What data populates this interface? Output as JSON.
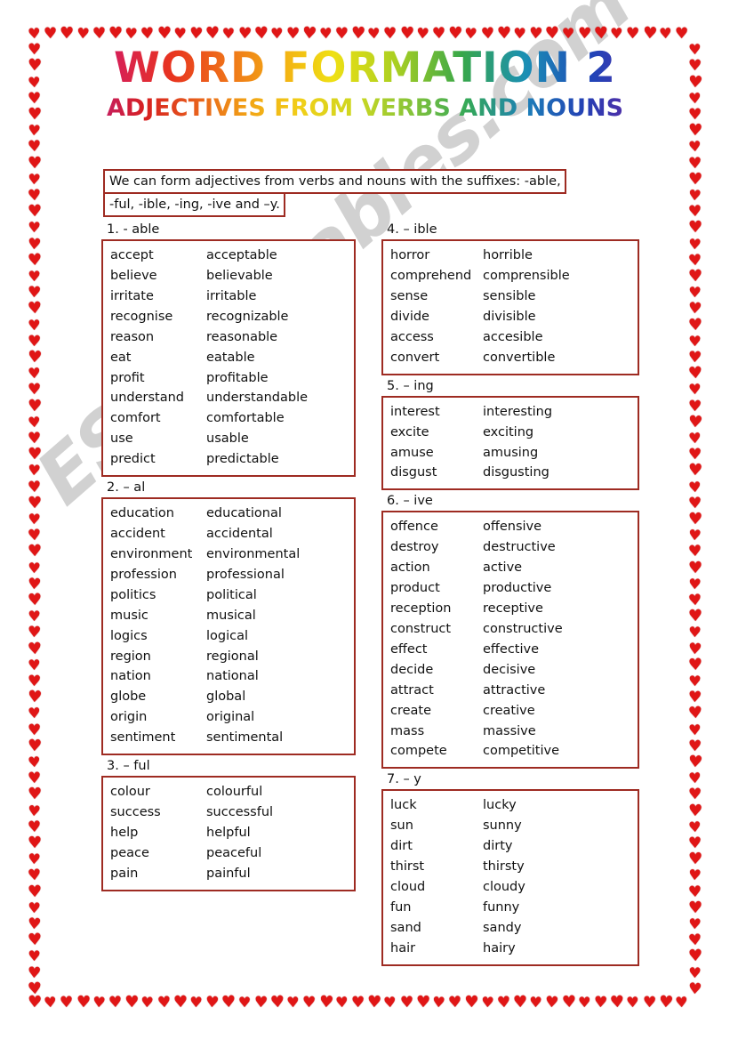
{
  "title": {
    "main": "WORD FORMATION 2",
    "sub": "ADJECTIVES FROM VERBS AND NOUNS"
  },
  "intro": {
    "line1": "We can form adjectives from verbs and nouns with the suffixes: -able,",
    "line2": "-ful, -ible, -ing, -ive and –y."
  },
  "watermark": "ESLprintables.com",
  "colors": {
    "box_border": "#9e2b22",
    "heart": "#e01616",
    "text": "#111111"
  },
  "left_column": [
    {
      "label": "1. - able",
      "rows": [
        {
          "base": "accept",
          "derived": "acceptable"
        },
        {
          "base": "believe",
          "derived": "believable"
        },
        {
          "base": "irritate",
          "derived": "irritable"
        },
        {
          "base": "recognise",
          "derived": "recognizable"
        },
        {
          "base": "reason",
          "derived": "reasonable"
        },
        {
          "base": "eat",
          "derived": "eatable"
        },
        {
          "base": "profit",
          "derived": "profitable"
        },
        {
          "base": "understand",
          "derived": "understandable"
        },
        {
          "base": "comfort",
          "derived": "comfortable"
        },
        {
          "base": "use",
          "derived": "usable"
        },
        {
          "base": "predict",
          "derived": "predictable"
        }
      ]
    },
    {
      "label": "2. – al",
      "rows": [
        {
          "base": "education",
          "derived": "educational"
        },
        {
          "base": "accident",
          "derived": "accidental"
        },
        {
          "base": "environment",
          "derived": "environmental"
        },
        {
          "base": "profession",
          "derived": "professional"
        },
        {
          "base": "politics",
          "derived": "political"
        },
        {
          "base": "music",
          "derived": "musical"
        },
        {
          "base": "logics",
          "derived": "logical"
        },
        {
          "base": "region",
          "derived": "regional"
        },
        {
          "base": "nation",
          "derived": "national"
        },
        {
          "base": "globe",
          "derived": "global"
        },
        {
          "base": "origin",
          "derived": "original"
        },
        {
          "base": "sentiment",
          "derived": "sentimental"
        }
      ]
    },
    {
      "label": "3. – ful",
      "rows": [
        {
          "base": "colour",
          "derived": "colourful"
        },
        {
          "base": "success",
          "derived": "successful"
        },
        {
          "base": "help",
          "derived": "helpful"
        },
        {
          "base": "peace",
          "derived": "peaceful"
        },
        {
          "base": "pain",
          "derived": "painful"
        }
      ]
    }
  ],
  "right_column": [
    {
      "label": "4. – ible",
      "rows": [
        {
          "base": "horror",
          "derived": "horrible"
        },
        {
          "base": "comprehend",
          "derived": "comprensible"
        },
        {
          "base": "sense",
          "derived": "sensible"
        },
        {
          "base": "divide",
          "derived": "divisible"
        },
        {
          "base": "access",
          "derived": "accesible"
        },
        {
          "base": "convert",
          "derived": "convertible"
        }
      ]
    },
    {
      "label": "5. – ing",
      "rows": [
        {
          "base": "interest",
          "derived": "interesting"
        },
        {
          "base": "excite",
          "derived": "exciting"
        },
        {
          "base": "amuse",
          "derived": "amusing"
        },
        {
          "base": "disgust",
          "derived": "disgusting"
        }
      ]
    },
    {
      "label": "6. – ive",
      "rows": [
        {
          "base": "offence",
          "derived": "offensive"
        },
        {
          "base": "destroy",
          "derived": "destructive"
        },
        {
          "base": "action",
          "derived": "active"
        },
        {
          "base": "product",
          "derived": "productive"
        },
        {
          "base": "reception",
          "derived": "receptive"
        },
        {
          "base": "construct",
          "derived": "constructive"
        },
        {
          "base": "effect",
          "derived": "effective"
        },
        {
          "base": "decide",
          "derived": "decisive"
        },
        {
          "base": "attract",
          "derived": "attractive"
        },
        {
          "base": "create",
          "derived": "creative"
        },
        {
          "base": "mass",
          "derived": "massive"
        },
        {
          "base": "compete",
          "derived": "competitive"
        }
      ]
    },
    {
      "label": "7. – y",
      "rows": [
        {
          "base": "luck",
          "derived": "lucky"
        },
        {
          "base": "sun",
          "derived": "sunny"
        },
        {
          "base": "dirt",
          "derived": "dirty"
        },
        {
          "base": "thirst",
          "derived": "thirsty"
        },
        {
          "base": "cloud",
          "derived": "cloudy"
        },
        {
          "base": "fun",
          "derived": "funny"
        },
        {
          "base": "sand",
          "derived": "sandy"
        },
        {
          "base": "hair",
          "derived": "hairy"
        }
      ]
    }
  ]
}
